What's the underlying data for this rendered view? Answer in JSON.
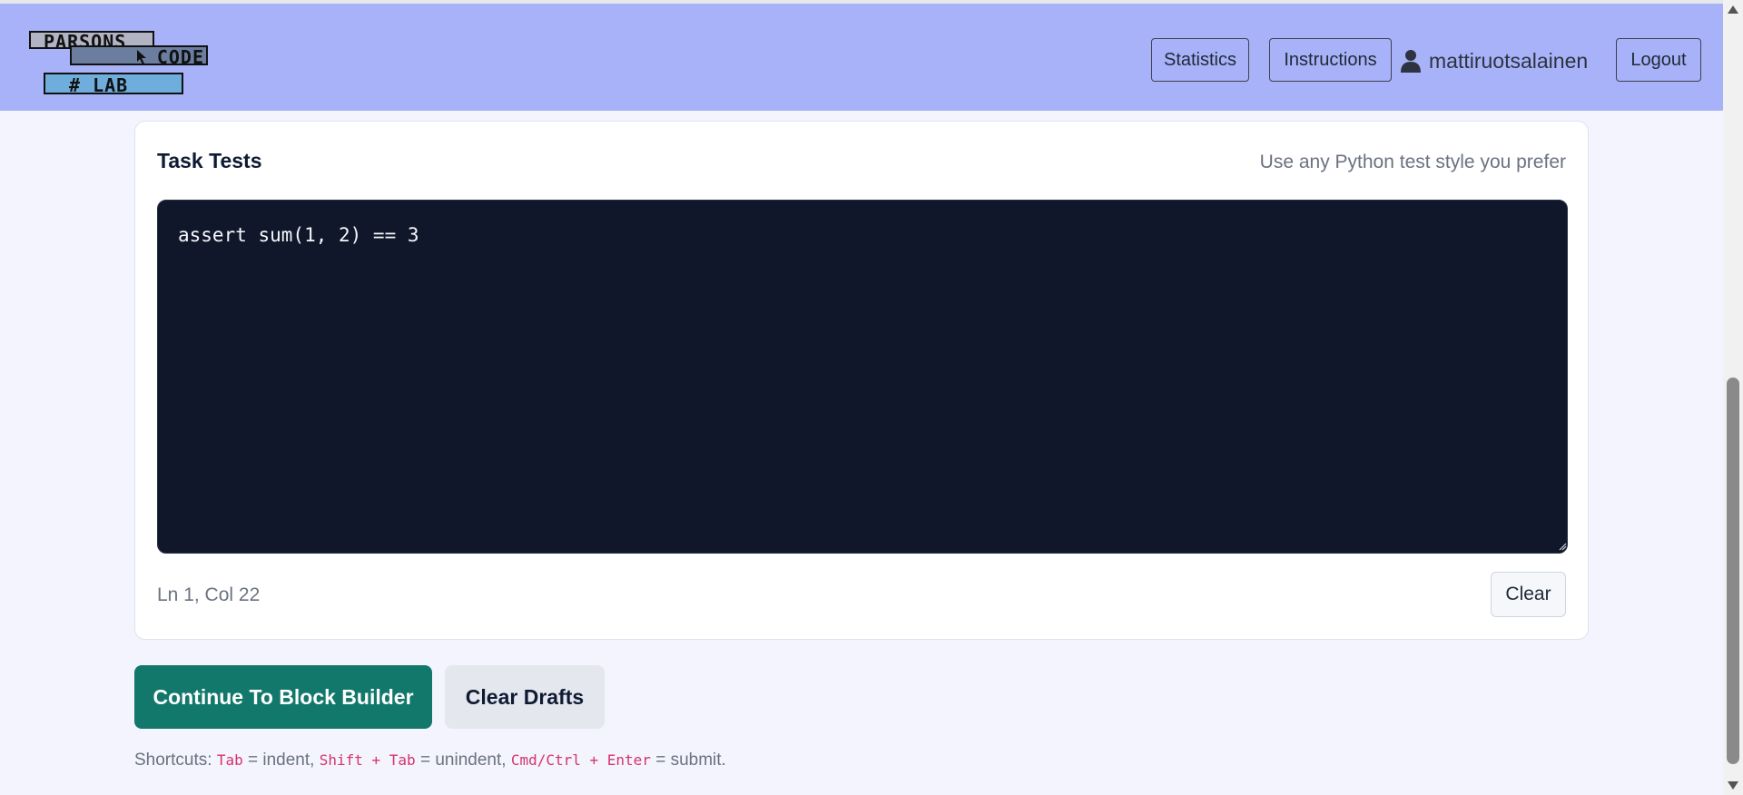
{
  "colors": {
    "header_bg": "#a8b2f8",
    "page_bg": "#f3f4fd",
    "editor_bg": "#10172a",
    "primary": "#12786b",
    "secondary": "#e4e7ee",
    "shortcut_code": "#d6336c"
  },
  "logo": {
    "line1": "PARSONS",
    "line2": "CODE",
    "line3": "# LAB"
  },
  "header": {
    "statistics_label": "Statistics",
    "instructions_label": "Instructions",
    "username": "mattiruotsalainen",
    "user_icon": "user-icon",
    "logout_label": "Logout"
  },
  "card": {
    "title": "Task Tests",
    "hint": "Use any Python test style you prefer",
    "editor_value": "assert sum(1, 2) == 3",
    "status": "Ln 1, Col 22",
    "clear_label": "Clear"
  },
  "actions": {
    "continue_label": "Continue To Block Builder",
    "clear_drafts_label": "Clear Drafts"
  },
  "shortcuts": {
    "prefix": "Shortcuts:",
    "k1": "Tab",
    "t1": "= indent,",
    "k2": "Shift + Tab",
    "t2": "= unindent,",
    "k3": "Cmd/Ctrl + Enter",
    "t3": "= submit."
  }
}
